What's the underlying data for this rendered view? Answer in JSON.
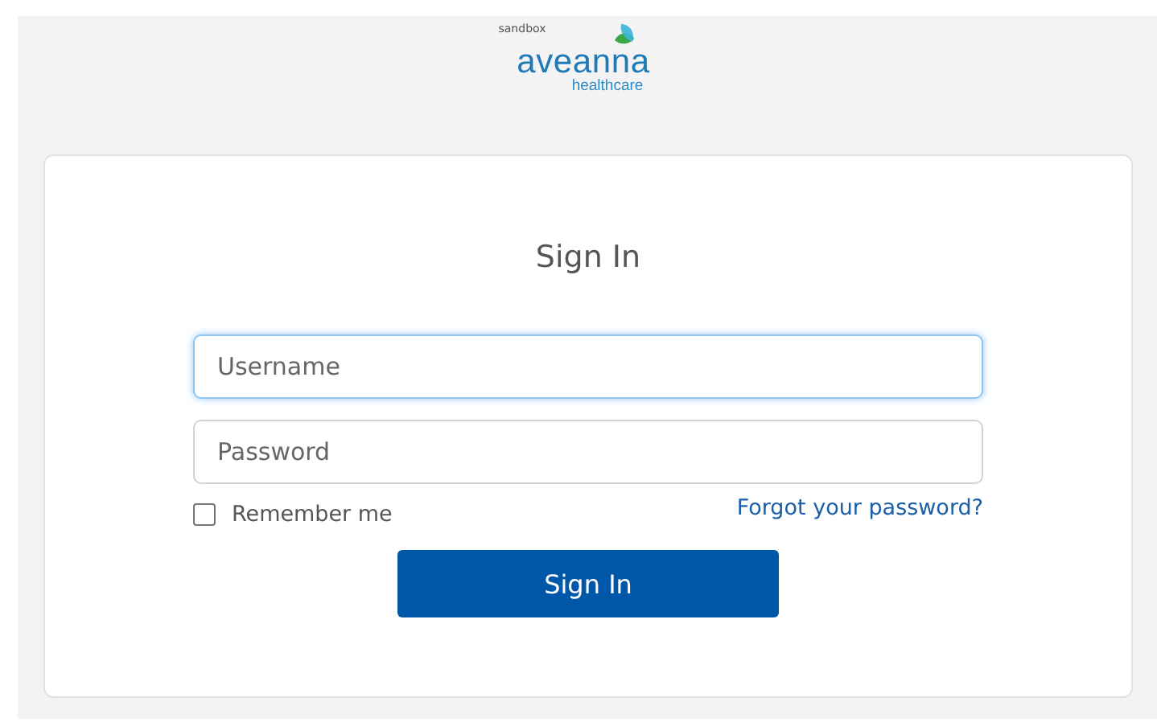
{
  "header": {
    "environment": "sandbox",
    "logo_name": "aveanna",
    "logo_tagline": "healthcare"
  },
  "form": {
    "title": "Sign In",
    "fields": [
      {
        "placeholder": "Username",
        "focused": true
      },
      {
        "placeholder": "Password",
        "focused": false
      }
    ],
    "remember": {
      "label": "Remember me",
      "checked": false
    },
    "forgot_link": "Forgot your password?",
    "submit": "Sign In"
  }
}
